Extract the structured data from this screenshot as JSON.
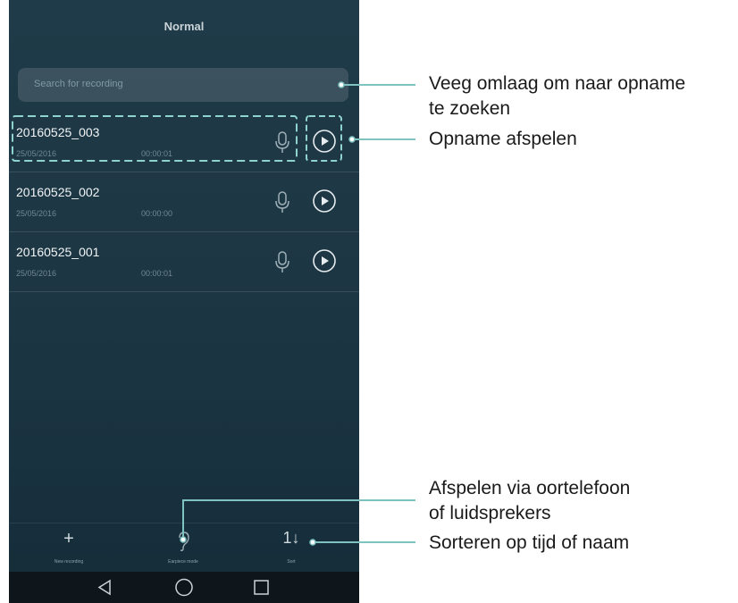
{
  "app": {
    "title": "Normal"
  },
  "search": {
    "placeholder": "Search for recording"
  },
  "recordings": [
    {
      "name": "20160525_003",
      "date": "25/05/2016",
      "duration": "00:00:01"
    },
    {
      "name": "20160525_002",
      "date": "25/05/2016",
      "duration": "00:00:00"
    },
    {
      "name": "20160525_001",
      "date": "25/05/2016",
      "duration": "00:00:01"
    }
  ],
  "bottom_bar": {
    "new_recording": "New recording",
    "earpiece_mode": "Earpiece mode",
    "sort": "Sort"
  },
  "annotations": {
    "search_line1": "Veeg omlaag om naar opname",
    "search_line2": "te zoeken",
    "play": "Opname afspelen",
    "earpiece_line1": "Afspelen via oortelefoon",
    "earpiece_line2": "of luidsprekers",
    "sort": "Sorteren op tijd of naam"
  },
  "colors": {
    "accent_line": "#7fc3c0"
  }
}
